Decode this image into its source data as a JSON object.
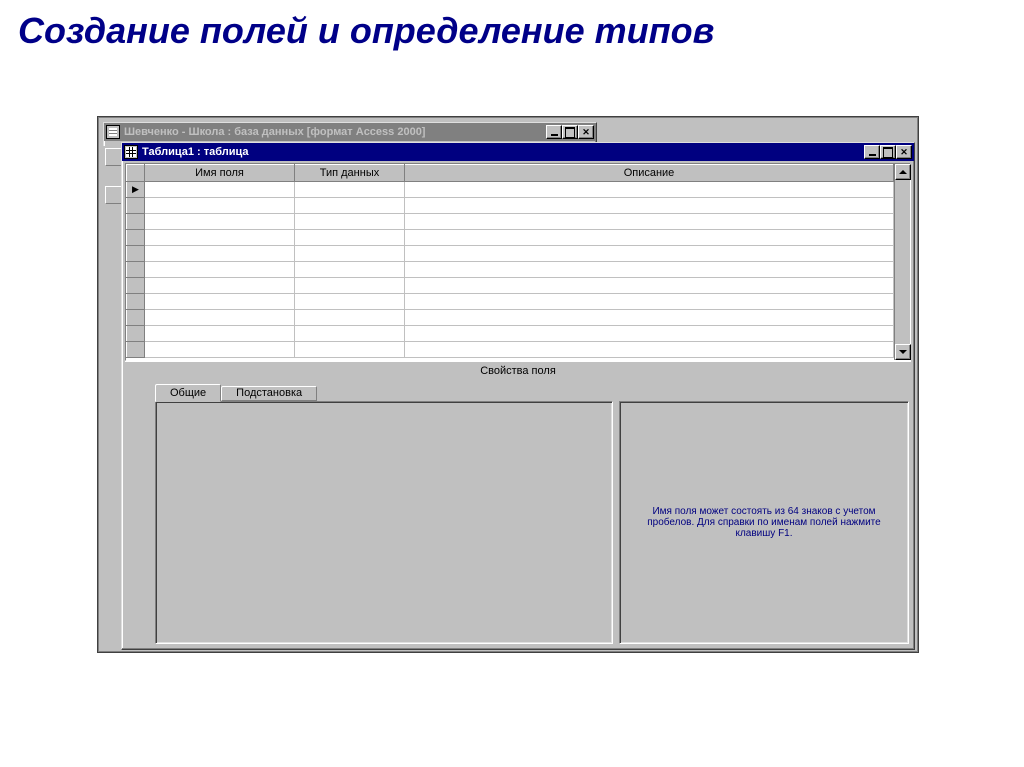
{
  "page_title": "Создание полей и определение типов",
  "db_window": {
    "title": "Шевченко - Школа : база данных [формат Access 2000]"
  },
  "table_window": {
    "title": "Таблица1 : таблица"
  },
  "grid": {
    "col_fieldname": "Имя поля",
    "col_datatype": "Тип данных",
    "col_description": "Описание",
    "current_row_marker": "▶"
  },
  "props": {
    "section_title": "Свойства поля",
    "tab_general": "Общие",
    "tab_lookup": "Подстановка"
  },
  "hint": "Имя поля может состоять из 64 знаков с учетом пробелов.  Для справки по именам полей нажмите клавишу F1."
}
